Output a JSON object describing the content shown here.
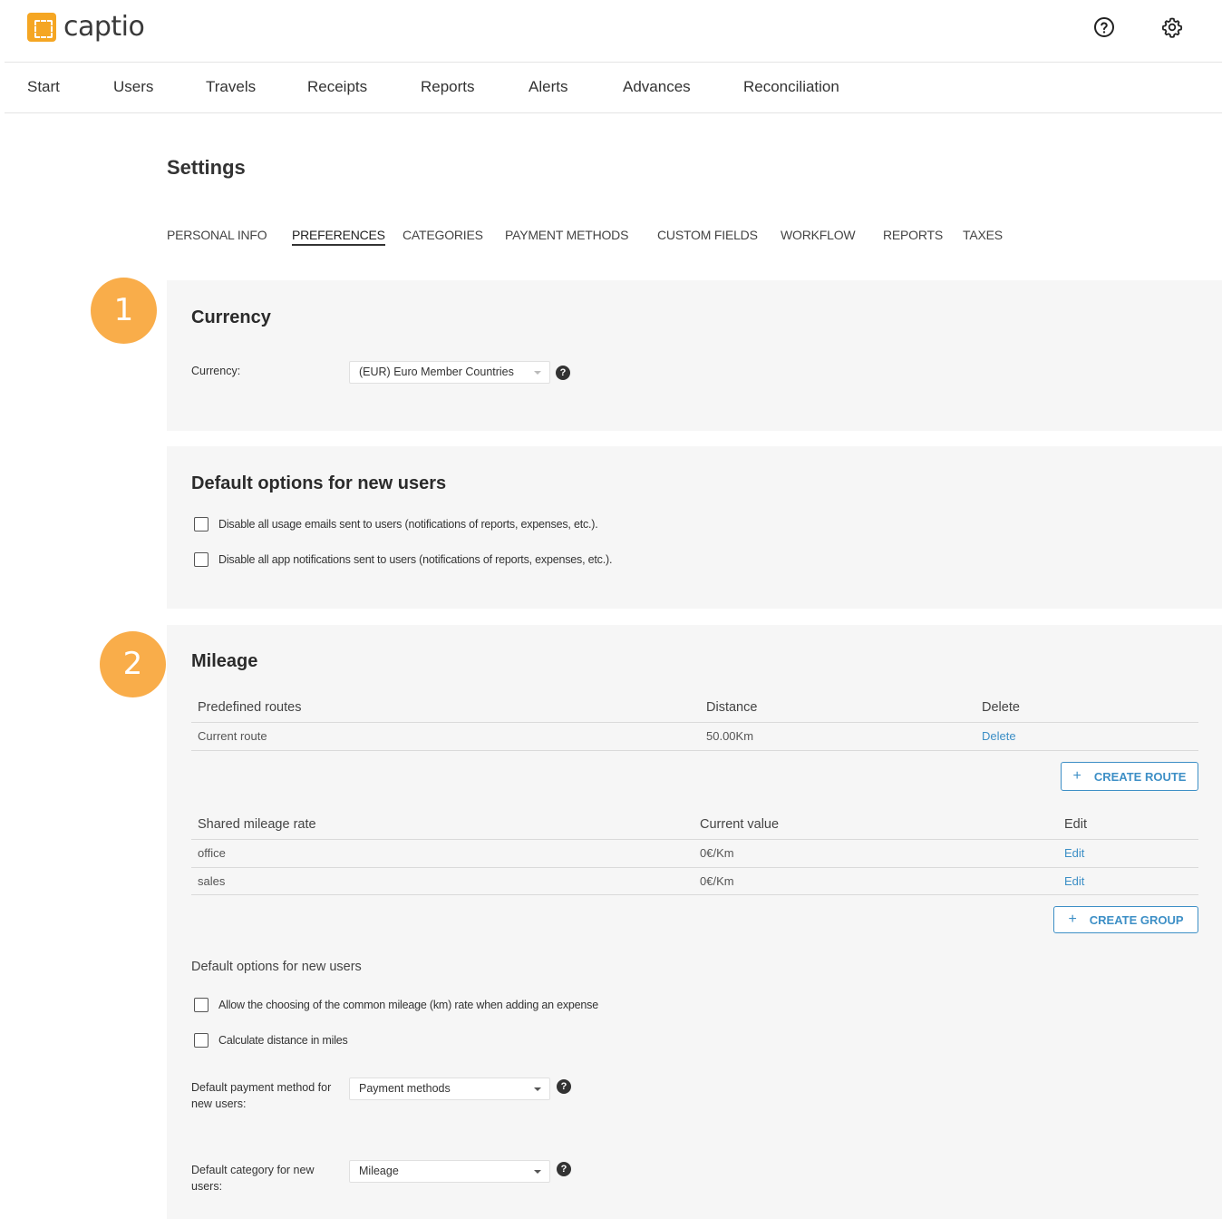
{
  "brand": {
    "name": "captio"
  },
  "nav": [
    "Start",
    "Users",
    "Travels",
    "Receipts",
    "Reports",
    "Alerts",
    "Advances",
    "Reconciliation"
  ],
  "page_title": "Settings",
  "tabs": [
    "PERSONAL INFO",
    "PREFERENCES",
    "CATEGORIES",
    "PAYMENT METHODS",
    "CUSTOM FIELDS",
    "WORKFLOW",
    "REPORTS",
    "TAXES"
  ],
  "active_tab": "PREFERENCES",
  "badges": [
    "1",
    "2"
  ],
  "currency": {
    "title": "Currency",
    "label": "Currency:",
    "value": "(EUR) Euro Member Countries"
  },
  "defaults": {
    "title": "Default options for new users",
    "options": [
      "Disable all usage emails sent to users (notifications of reports, expenses, etc.).",
      "Disable all app notifications sent to users (notifications of reports, expenses, etc.)."
    ]
  },
  "mileage": {
    "title": "Mileage",
    "routes": {
      "headers": [
        "Predefined routes",
        "Distance",
        "Delete"
      ],
      "rows": [
        {
          "name": "Current route",
          "distance": "50.00Km",
          "action": "Delete"
        }
      ],
      "button": "CREATE ROUTE"
    },
    "rates": {
      "headers": [
        "Shared mileage rate",
        "Current value",
        "Edit"
      ],
      "rows": [
        {
          "name": "office",
          "value": "0€/Km",
          "action": "Edit"
        },
        {
          "name": "sales",
          "value": "0€/Km",
          "action": "Edit"
        }
      ],
      "button": "CREATE GROUP"
    },
    "defaults_title": "Default options for new users",
    "options": [
      "Allow the choosing of the common mileage (km) rate when adding an expense",
      "Calculate distance in miles"
    ],
    "payment_label_1": "Default payment method for",
    "payment_label_2": "new users:",
    "payment_value": "Payment methods",
    "category_label_1": "Default category for new",
    "category_label_2": "users:",
    "category_value": "Mileage"
  },
  "icons": {
    "help": "help-circle-icon",
    "settings": "gear-icon",
    "question": "question-icon"
  },
  "colors": {
    "accent": "#3d8fc6",
    "badge": "#f9ad4a",
    "logo": "#f5a623",
    "panel": "#f6f6f6"
  }
}
